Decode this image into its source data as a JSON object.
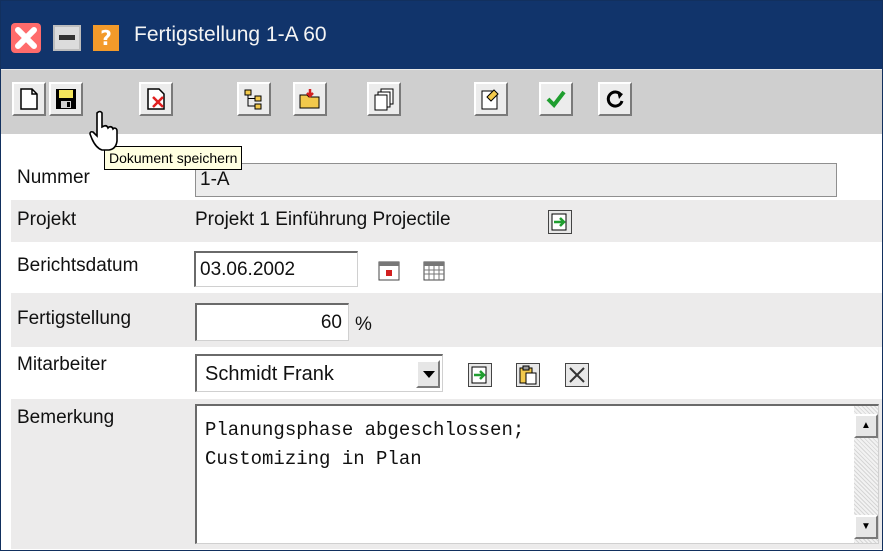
{
  "window": {
    "title": "Fertigstellung 1-A 60"
  },
  "titlebar_icons": [
    "close-icon",
    "minimize-icon",
    "help-icon"
  ],
  "help_glyph": "?",
  "toolbar": {
    "buttons": [
      {
        "name": "new-document-icon"
      },
      {
        "name": "save-icon"
      },
      {
        "name": "delete-icon"
      },
      {
        "name": "structure-icon"
      },
      {
        "name": "open-folder-icon"
      },
      {
        "name": "copy-icon"
      },
      {
        "name": "properties-icon"
      },
      {
        "name": "check-icon"
      },
      {
        "name": "refresh-icon"
      }
    ],
    "tooltip": "Dokument speichern"
  },
  "form": {
    "nummer_label": "Nummer",
    "nummer_value": "1-A",
    "projekt_label": "Projekt",
    "projekt_value": "Projekt 1 Einführung Projectile",
    "berichtsdatum_label": "Berichtsdatum",
    "berichtsdatum_value": "03.06.2002",
    "fertigstellung_label": "Fertigstellung",
    "fertigstellung_value": "60",
    "fertigstellung_unit": "%",
    "mitarbeiter_label": "Mitarbeiter",
    "mitarbeiter_value": "Schmidt Frank",
    "bemerkung_label": "Bemerkung",
    "bemerkung_value": "Planungsphase abgeschlossen;\nCustomizing in Plan"
  },
  "scrollbar": {
    "up_glyph": "▲",
    "down_glyph": "▼"
  },
  "colors": {
    "titlebar": "#11346b",
    "toolbar": "#cfcfcf",
    "row_alt": "#ecebeb",
    "tooltip_bg": "#ffffe1"
  }
}
